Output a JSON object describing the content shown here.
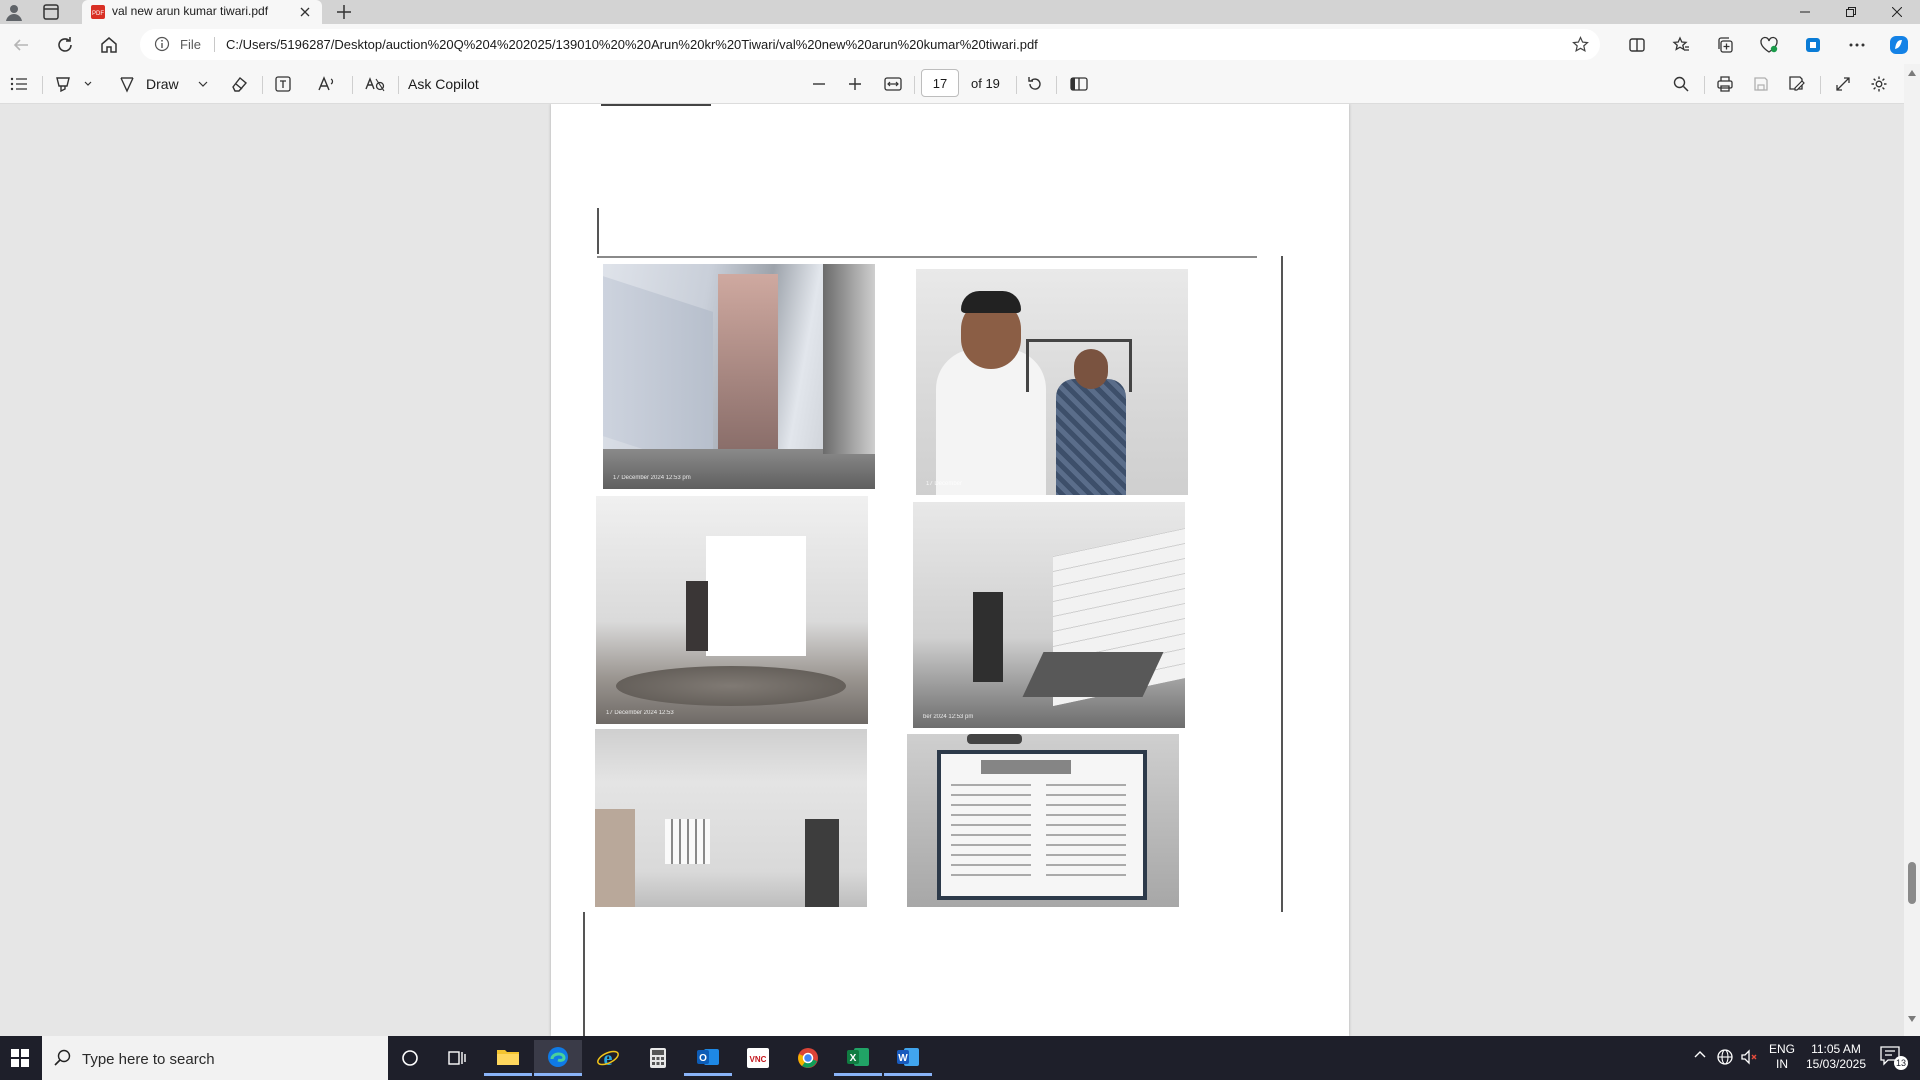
{
  "browser": {
    "tab_title": "val new arun kumar tiwari.pdf",
    "url_scheme_label": "File",
    "url": "C:/Users/5196287/Desktop/auction%20Q%204%202025/139010%20%20Arun%20kr%20Tiwari/val%20new%20arun%20kumar%20tiwari.pdf"
  },
  "pdf_toolbar": {
    "draw_label": "Draw",
    "ask_copilot_label": "Ask Copilot",
    "current_page": "17",
    "page_total_label": "of 19"
  },
  "photos": [
    {
      "stamp": "17 December 2024 12:53 pm"
    },
    {
      "stamp": "17 December"
    },
    {
      "stamp": "17 December 2024 12:53"
    },
    {
      "stamp": "ber 2024 12:53 pm"
    },
    {
      "stamp": ""
    },
    {
      "stamp": ""
    }
  ],
  "taskbar": {
    "search_placeholder": "Type here to search",
    "language_top": "ENG",
    "language_bottom": "IN",
    "time": "11:05 AM",
    "date": "15/03/2025",
    "notification_count": "13"
  },
  "colors": {
    "chrome_bg": "#f7f7f7",
    "titlebar_bg": "#d3d3d3",
    "viewer_bg": "#e6e6e6",
    "taskbar_bg": "#1e1f2a",
    "accent": "#0067c0"
  }
}
